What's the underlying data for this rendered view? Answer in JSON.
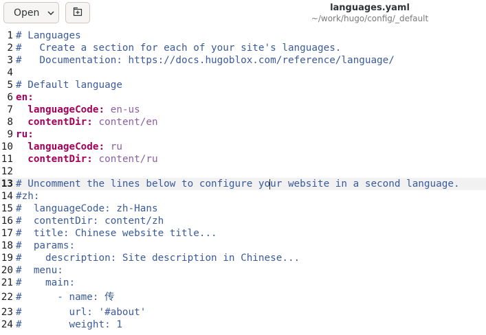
{
  "header": {
    "open_label": "Open",
    "open_icon": "chevron-down-icon",
    "new_tab_icon": "new-tab-icon",
    "file_title": "languages.yaml",
    "file_path": "~/work/hugo/config/_default"
  },
  "editor": {
    "current_line": 13,
    "lines": [
      {
        "num": "1",
        "code": "# Languages"
      },
      {
        "num": "2",
        "code": "#   Create a section for each of your site's languages."
      },
      {
        "num": "3",
        "code": "#   Documentation: https://docs.hugoblox.com/reference/language/"
      },
      {
        "num": "4",
        "code": ""
      },
      {
        "num": "5",
        "code": "# Default language"
      },
      {
        "num": "6",
        "key": "en",
        "sep": ":"
      },
      {
        "num": "7",
        "indent": "  ",
        "key": "languageCode",
        "sep": ": ",
        "value": "en-us"
      },
      {
        "num": "8",
        "indent": "  ",
        "key": "contentDir",
        "sep": ": ",
        "value": "content/en"
      },
      {
        "num": "9",
        "key": "ru",
        "sep": ":"
      },
      {
        "num": "10",
        "indent": "  ",
        "key": "languageCode",
        "sep": ": ",
        "value": "ru"
      },
      {
        "num": "11",
        "indent": "  ",
        "key": "contentDir",
        "sep": ": ",
        "value": "content/ru"
      },
      {
        "num": "12",
        "code": ""
      },
      {
        "num": "13",
        "code": "# Uncomment the lines below to configure your website in a second language."
      },
      {
        "num": "14",
        "code": "#zh:"
      },
      {
        "num": "15",
        "code": "#  languageCode: zh-Hans"
      },
      {
        "num": "16",
        "code": "#  contentDir: content/zh"
      },
      {
        "num": "17",
        "code": "#  title: Chinese website title..."
      },
      {
        "num": "18",
        "code": "#  params:"
      },
      {
        "num": "19",
        "code": "#    description: Site description in Chinese..."
      },
      {
        "num": "20",
        "code": "#  menu:"
      },
      {
        "num": "21",
        "code": "#    main:"
      },
      {
        "num": "22",
        "code": "#      - name: 传"
      },
      {
        "num": "23",
        "code": "#        url: '#about'"
      },
      {
        "num": "24",
        "code": "#        weight: 1"
      }
    ]
  }
}
